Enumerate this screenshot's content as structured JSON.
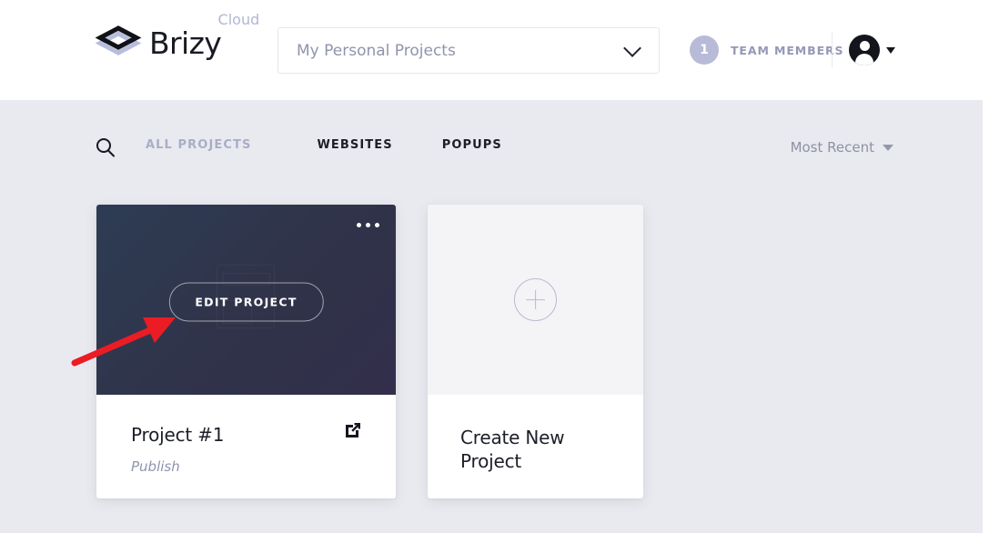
{
  "header": {
    "brand_name": "Brizy",
    "brand_superscript": "Cloud",
    "logo_icon": "brizy-diamond-logo",
    "project_select": {
      "value": "My Personal Projects",
      "icon": "chevron-down-icon"
    },
    "team": {
      "count": "1",
      "label": "TEAM MEMBERS"
    },
    "account": {
      "avatar_icon": "user-avatar-icon",
      "caret_icon": "caret-down-icon"
    }
  },
  "toolbar": {
    "search_icon": "search-icon",
    "tabs": [
      {
        "label": "ALL PROJECTS",
        "active": true
      },
      {
        "label": "WEBSITES",
        "active": false
      },
      {
        "label": "POPUPS",
        "active": false
      }
    ],
    "sort": {
      "label": "Most Recent",
      "icon": "caret-down-icon"
    }
  },
  "cards": {
    "project": {
      "title": "Project #1",
      "status": "Publish",
      "edit_label": "EDIT PROJECT",
      "menu_icon": "more-options-icon",
      "external_link_icon": "external-link-icon"
    },
    "create": {
      "title": "Create New Project",
      "plus_icon": "plus-circle-icon"
    }
  },
  "annotation": {
    "arrow_color": "#ec1c24",
    "arrow_target": "edit-project-button"
  },
  "colors": {
    "page_background": "#e9eaef",
    "header_background": "#ffffff",
    "accent_muted": "#a9adc8",
    "text_dark": "#1d1f28",
    "thumb_gradient_start": "#2d3c54",
    "thumb_gradient_end": "#322e4b"
  }
}
